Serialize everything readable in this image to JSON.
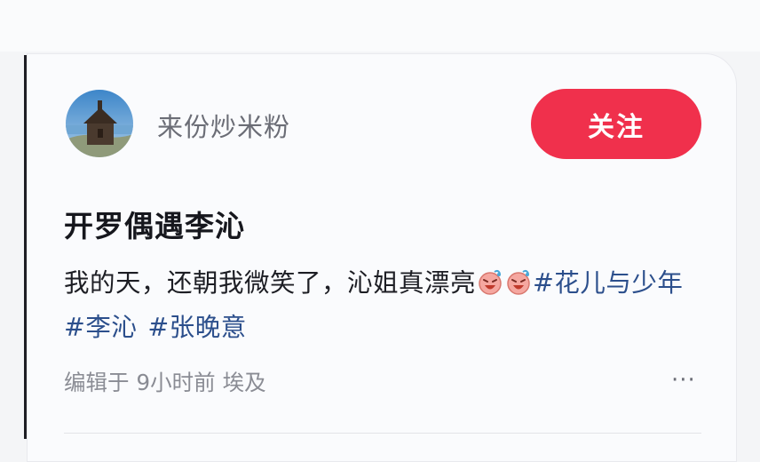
{
  "post": {
    "author": "来份炒米粉",
    "follow_label": "关注",
    "title": "开罗偶遇李沁",
    "body_text": "我的天，还朝我微笑了，沁姐真漂亮",
    "emoji_name": "laughing-face-emoji",
    "tags": [
      "#花儿与少年",
      "#李沁",
      "#张晚意"
    ],
    "meta": {
      "edited_label": "编辑于",
      "time_ago": "9小时前",
      "location": "埃及"
    },
    "more_label": "···"
  },
  "colors": {
    "follow_button": "#f0304c",
    "tag_link": "#2c4f8c",
    "meta_text": "#8a8c94"
  }
}
